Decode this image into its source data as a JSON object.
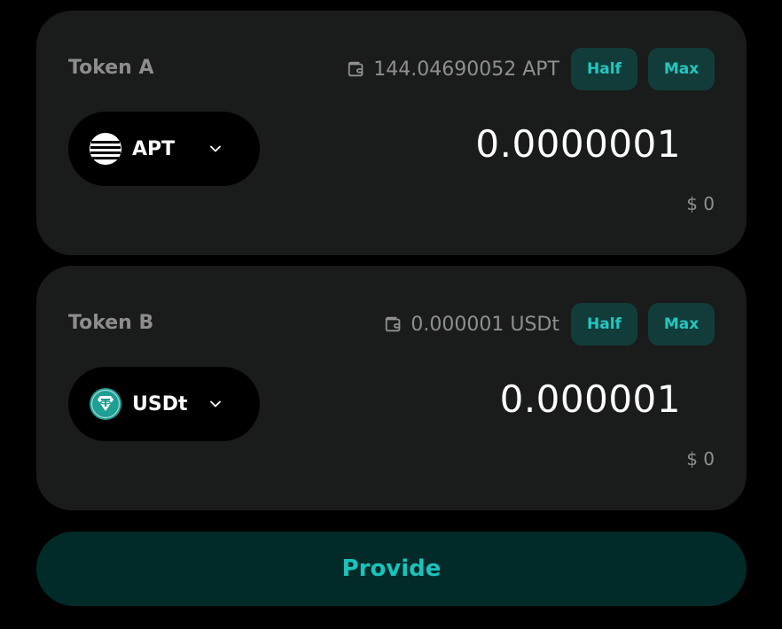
{
  "colors": {
    "page_bg": "#000000",
    "card_bg": "#1a1b1b",
    "accent": "#22c7bf",
    "button_bg": "#123c3a",
    "provide_bg": "#022a29",
    "muted_text": "#8f8f8f"
  },
  "token_a": {
    "label": "Token A",
    "balance": "144.04690052 APT",
    "half_label": "Half",
    "max_label": "Max",
    "symbol": "APT",
    "logo_icon": "aptos-logo-icon",
    "amount": "0.0000001",
    "usd_value": "$ 0"
  },
  "token_b": {
    "label": "Token B",
    "balance": "0.000001 USDt",
    "half_label": "Half",
    "max_label": "Max",
    "symbol": "USDt",
    "logo_icon": "tether-logo-icon",
    "amount": "0.000001",
    "usd_value": "$ 0"
  },
  "provide_label": "Provide"
}
